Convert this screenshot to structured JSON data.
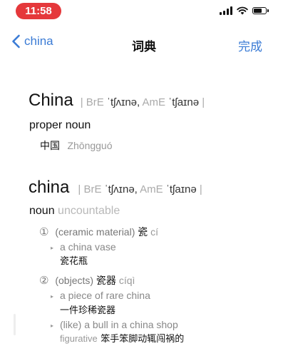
{
  "status_bar": {
    "time": "11:58",
    "battery_level": 0.7
  },
  "nav": {
    "back_label": "china",
    "title": "词典",
    "done_label": "完成",
    "accent_color": "#3a7bd5"
  },
  "entries": [
    {
      "headword": "China",
      "pron_bre_label": "BrE",
      "pron_bre": "ˈtʃʌɪnə,",
      "pron_ame_label": "AmE",
      "pron_ame": "ˈtʃaɪnə",
      "pos": "proper noun",
      "translation": "中国",
      "pinyin": "Zhōngguó"
    },
    {
      "headword": "china",
      "pron_bre_label": "BrE",
      "pron_bre": "ˈtʃʌɪnə,",
      "pron_ame_label": "AmE",
      "pron_ame": "ˈtʃaɪnə",
      "pos": "noun",
      "pos_note": "uncountable",
      "senses": [
        {
          "number": "①",
          "gloss": "(ceramic material)",
          "cn": "瓷",
          "pinyin": "cí",
          "examples": [
            {
              "en": "a china vase",
              "cn": "瓷花瓶"
            }
          ]
        },
        {
          "number": "②",
          "gloss": "(objects)",
          "cn": "瓷器",
          "pinyin": "cíqì",
          "examples": [
            {
              "en": "a piece of rare china",
              "cn": "一件珍稀瓷器"
            },
            {
              "en": "(like) a bull in a china shop",
              "note": "figurative",
              "cn": "笨手笨脚动辄闯祸的"
            }
          ]
        }
      ]
    }
  ]
}
